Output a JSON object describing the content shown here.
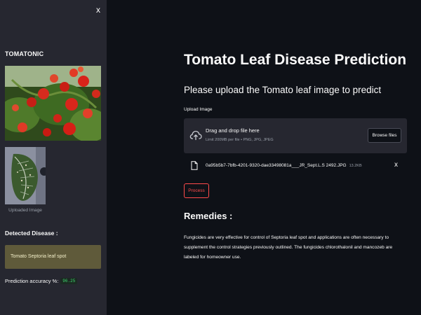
{
  "sidebar": {
    "close_label": "x",
    "brand": "TOMATONIC",
    "uploaded_caption": "Uploaded Image",
    "detected_label": "Detected Disease :",
    "detected_value": "Tomato Septoria leaf spot",
    "accuracy_label": "Prediction accuracy %:",
    "accuracy_value": "96.25"
  },
  "main": {
    "title": "Tomato Leaf Disease Prediction",
    "subtitle": "Please upload the Tomato leaf image to predict",
    "upload_label": "Upload Image",
    "dropzone_text": "Drag and drop file here",
    "dropzone_limit": "Limit 200MB per file • PNG, JPG, JPEG",
    "browse_label": "Browse files",
    "file_name": "0a95b5b7-7bfb-4201-9320-dae33498081a___JR_Sept.L.S 2492.JPG",
    "file_size": "13.2KB",
    "file_remove_label": "x",
    "process_label": "Process",
    "remedies_title": "Remedies :",
    "remedies_text": "Fungicides are very effective for control of Septoria leaf spot and applications are often necessary to supplement the control strategies previously outlined. The fungicides chlorothalonil and mancozeb are labeled for homeowner use."
  },
  "colors": {
    "background": "#0e1117",
    "sidebar": "#262730",
    "accent": "#ff4b4b",
    "detected_box": "#5f5a3a",
    "accuracy_green": "#3dd56d"
  },
  "icons": {
    "close": "close-icon",
    "upload": "cloud-upload-icon",
    "file": "file-icon",
    "remove": "close-icon"
  }
}
